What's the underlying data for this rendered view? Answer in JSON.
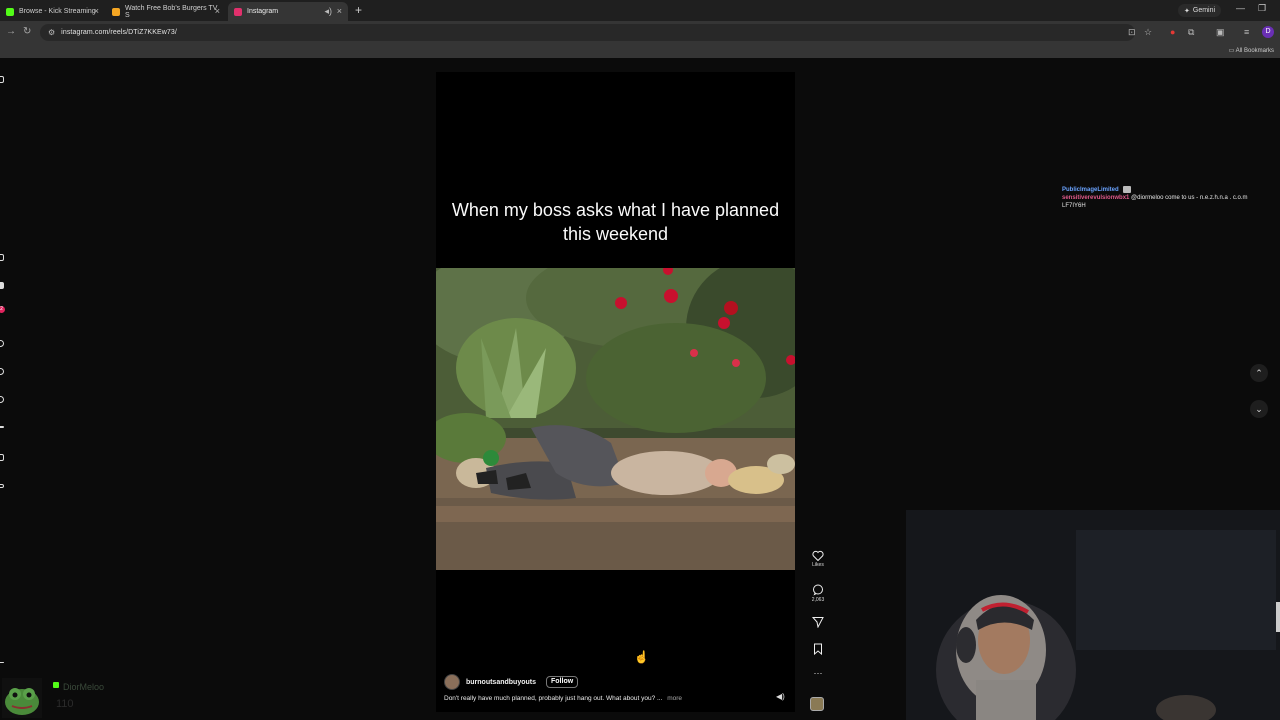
{
  "browser": {
    "tabs": [
      {
        "title": "Browse - Kick Streaming",
        "active": false,
        "favicon_color": "#53fc18"
      },
      {
        "title": "Watch Free Bob's Burgers TV S",
        "active": false,
        "favicon_color": "#f5a623"
      },
      {
        "title": "Instagram",
        "active": true,
        "favicon_color": "#e1306c"
      }
    ],
    "new_tab_icon": "plus-icon",
    "gemini_label": "Gemini",
    "url": "instagram.com/reels/DTiZ7KKEw73/",
    "profile_initial": "D",
    "all_bookmarks_label": "All Bookmarks"
  },
  "reel": {
    "overlay_caption": "When my boss asks what I have planned this weekend",
    "author": "burnoutsandbuyouts",
    "follow_label": "Follow",
    "description": "Don't really have much planned, probably just hang out. What about you? ...",
    "more_label": "more",
    "actions": {
      "likes_label": "Likes",
      "comments_count": "2,063"
    }
  },
  "chat": [
    {
      "user": "PublicImageLimited",
      "message": ""
    },
    {
      "user": "sensitiverevulsionwbx1",
      "message": "@diormeloo come to us - n.e.z.h.n.a . c.o.m LF7IY6H"
    }
  ],
  "kick_user": {
    "name": "DiorMeloo",
    "count": "110"
  },
  "colors": {
    "accent_instagram": "#e1306c",
    "kick_green": "#53fc18",
    "chat_user_1": "#6aa3ff",
    "chat_user_2": "#e05a8a"
  }
}
